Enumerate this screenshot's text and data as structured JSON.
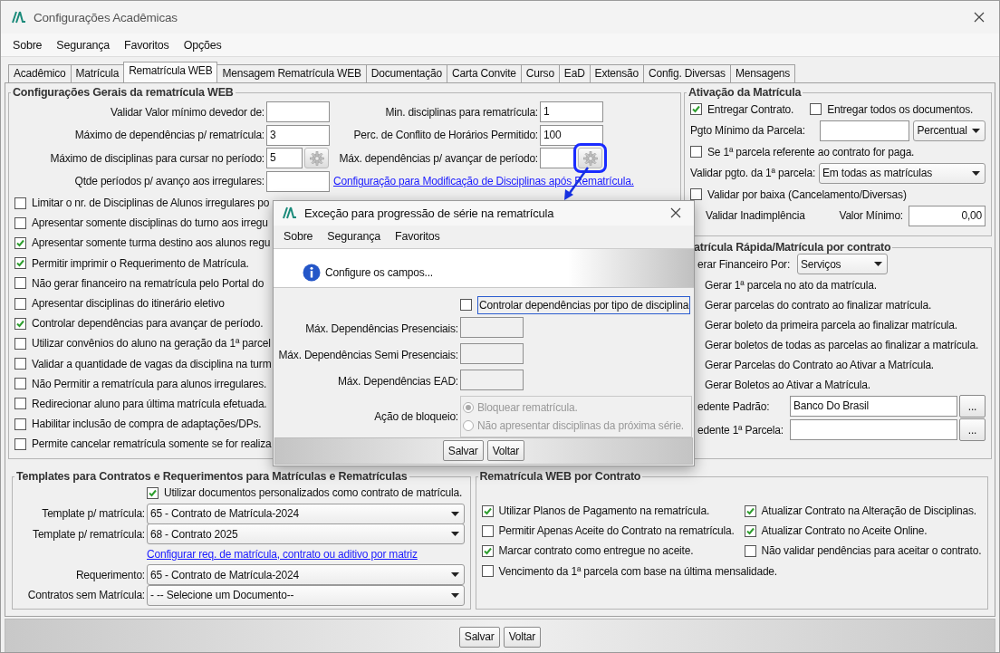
{
  "window": {
    "title": "Configurações Acadêmicas"
  },
  "menu": [
    "Sobre",
    "Segurança",
    "Favoritos",
    "Opções"
  ],
  "tabs": [
    {
      "label": "Acadêmico",
      "selected": false
    },
    {
      "label": "Matrícula",
      "selected": false
    },
    {
      "label": "Rematrícula WEB",
      "selected": true
    },
    {
      "label": "Mensagem Rematrícula WEB",
      "selected": false
    },
    {
      "label": "Documentação",
      "selected": false
    },
    {
      "label": "Carta Convite",
      "selected": false
    },
    {
      "label": "Curso",
      "selected": false
    },
    {
      "label": "EaD",
      "selected": false
    },
    {
      "label": "Extensão",
      "selected": false
    },
    {
      "label": "Config. Diversas",
      "selected": false
    },
    {
      "label": "Mensagens",
      "selected": false
    }
  ],
  "general": {
    "title": "Configurações Gerais da rematrícula WEB",
    "rows": [
      {
        "left": {
          "label": "Validar Valor mínimo devedor de:",
          "gear": false
        },
        "right": {
          "label": "Min. disciplinas para rematrícula:",
          "value": "1",
          "gear": false
        }
      },
      {
        "left": {
          "label": "Máximo de dependências p/ rematrícula:",
          "value": "3",
          "gear": false
        },
        "right": {
          "label": "Perc. de Conflito de Horários Permitido:",
          "value": "100",
          "gear": false
        }
      },
      {
        "left": {
          "label": "Máximo de disciplinas para cursar no período:",
          "value": "5",
          "gear": true,
          "highlighted": false
        },
        "right": {
          "label": "Máx. dependências p/ avançar de período:",
          "gear": true,
          "highlighted": true
        }
      },
      {
        "left": {
          "label": "Qtde períodos p/ avanço aos irregulares:",
          "gear": false
        },
        "link": "Configuração para Modificação de Disciplinas após Rematrícula."
      }
    ],
    "checks": [
      {
        "label": "Limitar o nr. de Disciplinas de Alunos irregulares po",
        "checked": false
      },
      {
        "label": "Apresentar somente disciplinas do turno aos irregu",
        "checked": false
      },
      {
        "label": "Apresentar somente turma destino aos alunos regu",
        "checked": true
      },
      {
        "label": "Permitir imprimir o Requerimento de Matrícula.",
        "checked": true
      },
      {
        "label": "Não gerar financeiro na rematrícula pelo Portal do",
        "checked": false
      },
      {
        "label": "Apresentar disciplinas do itinerário eletivo",
        "checked": false
      },
      {
        "label": "Controlar dependências para avançar de período.",
        "checked": true
      },
      {
        "label": "Utilizar convênios do aluno na geração da 1ª parcel",
        "checked": false
      },
      {
        "label": "Validar a quantidade de vagas da disciplina na turm",
        "checked": false
      },
      {
        "label": "Não Permitir a rematrícula para alunos irregulares.",
        "checked": false
      },
      {
        "label": "Redirecionar aluno para última matrícula efetuada.",
        "checked": false
      },
      {
        "label": "Habilitar inclusão de compra de adaptações/DPs.",
        "checked": false
      },
      {
        "label": "Permite cancelar rematrícula somente se for realiza",
        "checked": false
      }
    ]
  },
  "activation": {
    "title": "Ativação da Matrícula",
    "items": [
      {
        "kind": "checks",
        "items": [
          {
            "label": "Entregar Contrato.",
            "checked": true
          },
          {
            "label": "Entregar todos os documentos.",
            "checked": false
          }
        ]
      },
      {
        "kind": "input-select",
        "label": "Pgto Mínimo da Parcela:",
        "select": "Percentual"
      },
      {
        "kind": "check",
        "label": "Se 1ª parcela referente ao contrato for paga.",
        "checked": false
      },
      {
        "kind": "select",
        "label": "Validar pgto. da 1ª parcela:",
        "select": "Em todas as matrículas"
      },
      {
        "kind": "check",
        "label": "Validar por baixa (Cancelamento/Diversas)",
        "checked": false
      },
      {
        "kind": "check-input",
        "label": "Validar Inadimplência",
        "input_label": "Valor Mínimo:",
        "value": "0,00"
      }
    ]
  },
  "quick": {
    "title": "atrícula Rápida/Matrícula por contrato",
    "financeiro_label": "erar Financeiro Por:",
    "financeiro": "Serviços",
    "options": [
      "Gerar 1ª parcela no ato da matrícula.",
      "Gerar parcelas do contrato ao finalizar matrícula.",
      "Gerar boleto da primeira parcela ao finalizar matrícula.",
      "Gerar boletos de todas as parcelas ao finalizar a matrícula.",
      "Gerar Parcelas do Contrato ao Ativar a Matrícula.",
      "Gerar Boletos ao Ativar a Matrícula."
    ],
    "cedentes": [
      {
        "label": "edente Padrão:",
        "value": "Banco Do Brasil",
        "button": "..."
      },
      {
        "label": "edente 1ª Parcela:",
        "button": "..."
      }
    ]
  },
  "templates": {
    "title": "Templates para Contratos e Requerimentos para Matrículas e Rematrículas",
    "use_custom": {
      "label": "Utilizar documentos personalizados como contrato de matrícula.",
      "checked": true
    },
    "rows": [
      {
        "kind": "select",
        "label": "Template p/ matrícula:",
        "value": "65 - Contrato de Matrícula-2024"
      },
      {
        "kind": "select",
        "label": "Template p/ rematrícula:",
        "value": "68 - Contrato 2025"
      },
      {
        "kind": "link",
        "label": "Configurar req. de matrícula, contrato ou aditivo por matriz"
      },
      {
        "kind": "select",
        "label": "Requerimento:",
        "value": "65 - Contrato de Matrícula-2024"
      },
      {
        "kind": "select",
        "label": "Contratos sem Matrícula:",
        "value": "- -- Selecione um Documento--"
      }
    ]
  },
  "contract": {
    "title": "Rematrícula WEB por Contrato",
    "checks": [
      {
        "label": "Utilizar Planos de Pagamento na rematrícula.",
        "checked": true
      },
      {
        "label": "Atualizar Contrato na Alteração de Disciplinas.",
        "checked": true
      },
      {
        "label": "Permitir Apenas Aceite do Contrato na rematrícula.",
        "checked": false
      },
      {
        "label": "Atualizar Contrato no Aceite Online.",
        "checked": true
      },
      {
        "label": "Marcar contrato como entregue no aceite.",
        "checked": true
      },
      {
        "label": "Não validar pendências para aceitar o contrato.",
        "checked": false
      },
      {
        "label": "Vencimento da 1ª parcela com base na última mensalidade.",
        "checked": false
      }
    ]
  },
  "dialog": {
    "title": "Exceção para progressão de série na rematrícula",
    "menu": [
      "Sobre",
      "Segurança",
      "Favoritos"
    ],
    "message": "Configure os campos...",
    "check": {
      "label": "Controlar dependências por tipo de disciplina",
      "checked": false
    },
    "fields": [
      "Máx. Dependências Presenciais:",
      "Máx. Dependências Semi Presenciais:",
      "Máx. Dependências EAD:"
    ],
    "action_label": "Ação de bloqueio:",
    "radios_disabled": true,
    "radios": [
      {
        "label": "Bloquear rematrícula.",
        "selected": true
      },
      {
        "label": "Não apresentar disciplinas da próxima série.",
        "selected": false
      }
    ],
    "buttons": [
      "Salvar",
      "Voltar"
    ]
  },
  "buttons": [
    "Salvar",
    "Voltar"
  ]
}
